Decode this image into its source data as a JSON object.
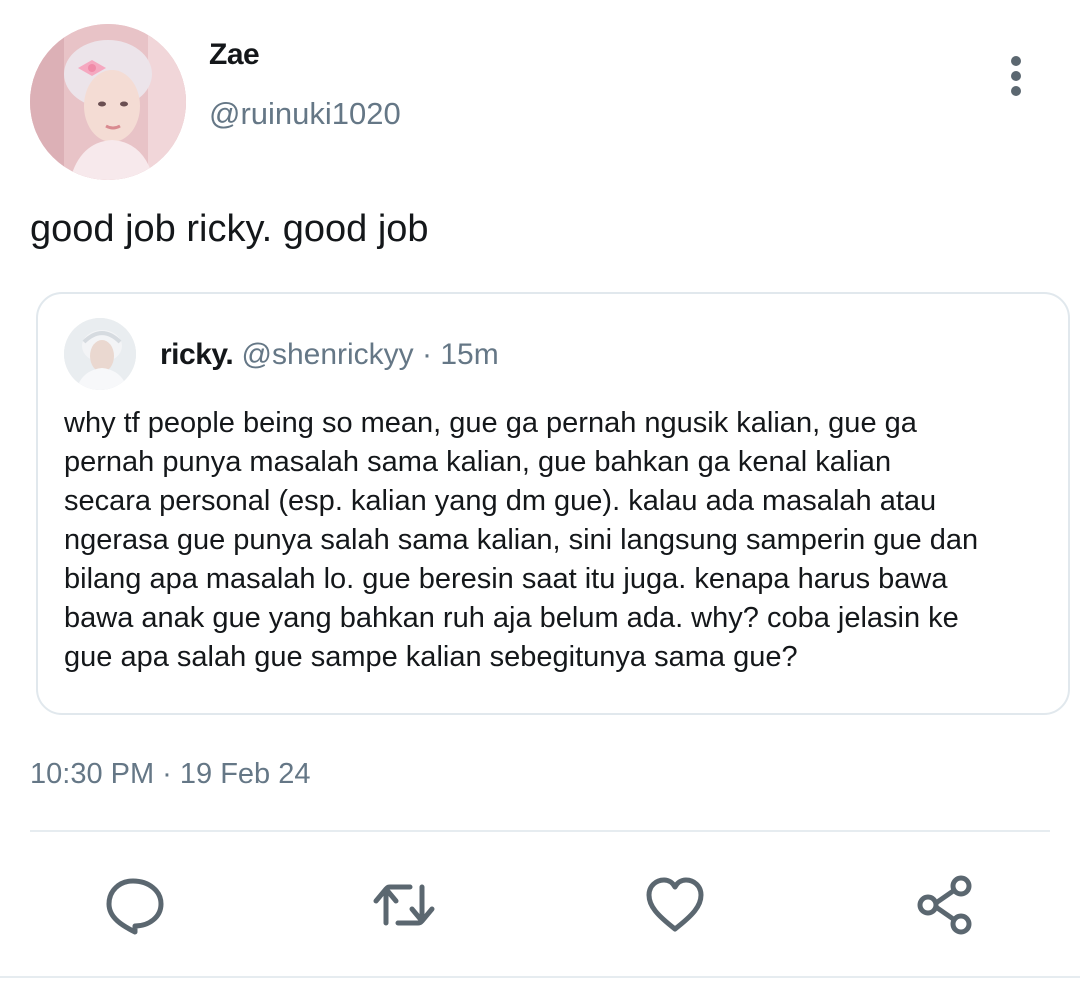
{
  "author": {
    "display_name": "Zae",
    "handle": "@ruinuki1020",
    "avatar_icon": "avatar-photo"
  },
  "tweet": {
    "text": "good job ricky. good job",
    "timestamp": "10:30 PM · 19 Feb 24"
  },
  "quoted_tweet": {
    "display_name": "ricky.",
    "handle": "@shenrickyy",
    "separator": "·",
    "time": "15m",
    "lines": [
      "why tf people being so mean, gue ga pernah ngusik kalian, gue ga",
      "pernah punya masalah sama kalian, gue bahkan ga kenal kalian",
      "secara personal (esp. kalian yang dm gue). kalau ada masalah atau",
      "ngerasa gue punya salah sama kalian, sini langsung samperin gue dan",
      "bilang apa masalah lo. gue beresin saat itu juga. kenapa harus bawa",
      "bawa anak gue yang bahkan ruh aja belum ada. why? coba jelasin ke",
      "gue apa salah gue sampe kalian sebegitunya sama gue?"
    ]
  },
  "actions": {
    "reply_icon": "speech-bubble",
    "retweet_icon": "retweet-arrows",
    "like_icon": "heart-outline",
    "share_icon": "share-nodes"
  },
  "colors": {
    "text": "#14171a",
    "secondary": "#657786",
    "border": "#e1e8ed",
    "icon": "#5b6770"
  }
}
